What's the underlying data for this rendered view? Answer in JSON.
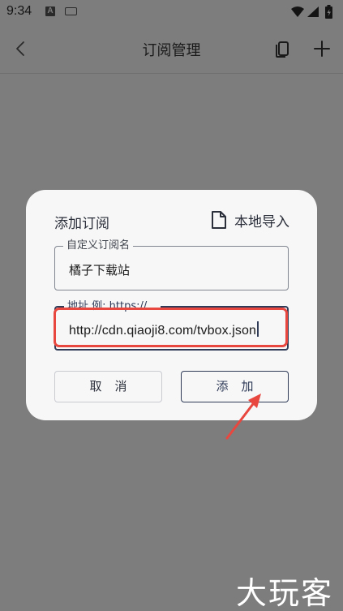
{
  "status_bar": {
    "time": "9:34",
    "notification_letter": "A"
  },
  "app_bar": {
    "title": "订阅管理"
  },
  "dialog": {
    "title": "添加订阅",
    "import_label": "本地导入",
    "name_field": {
      "label": "自定义订阅名",
      "value": "橘子下载站"
    },
    "url_field": {
      "label": "地址 例: https://...",
      "value": "http://cdn.qiaoji8.com/tvbox.json"
    },
    "cancel_label": "取消",
    "add_label": "添加"
  },
  "watermark": "大玩客",
  "colors": {
    "highlight": "#e8473f",
    "accent": "#2f3b57",
    "scrim": "#7d7d7d"
  }
}
